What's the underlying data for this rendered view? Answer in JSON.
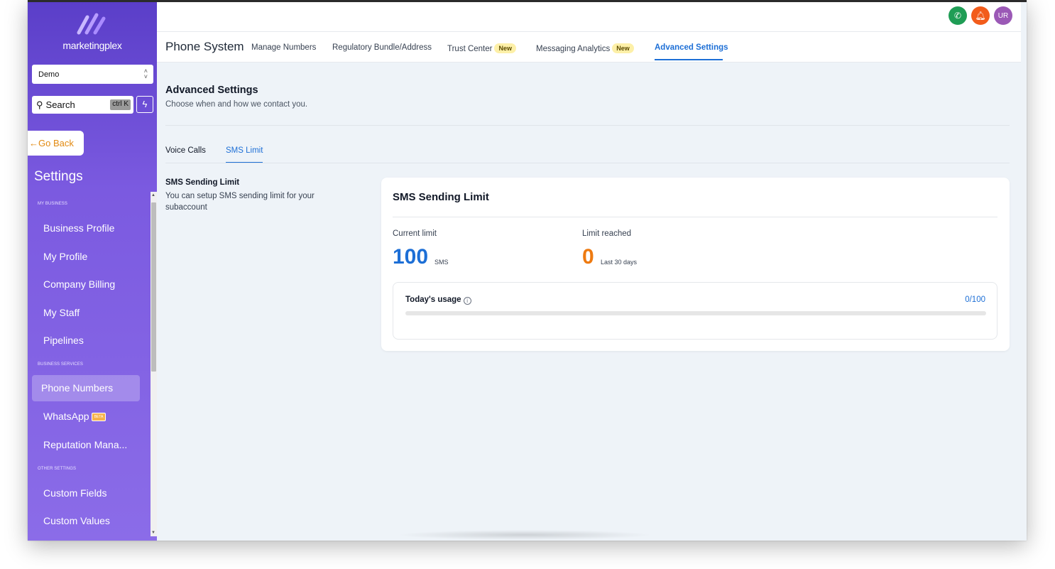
{
  "sidebar": {
    "brand": "marketingplex",
    "account": "Demo",
    "search_placeholder": "Search",
    "search_shortcut": "ctrl K",
    "go_back": "Go Back",
    "settings_title": "Settings",
    "sections": {
      "my_business": "MY BUSINESS",
      "business_services": "BUSINESS SERVICES",
      "other_settings": "OTHER SETTINGS"
    },
    "items": {
      "business_profile": "Business Profile",
      "my_profile": "My Profile",
      "company_billing": "Company Billing",
      "my_staff": "My Staff",
      "pipelines": "Pipelines",
      "phone_numbers": "Phone Numbers",
      "whatsapp": "WhatsApp",
      "whatsapp_badge": "BETA",
      "reputation": "Reputation Mana...",
      "custom_fields": "Custom Fields",
      "custom_values": "Custom Values"
    }
  },
  "header": {
    "avatar_initials": "UR",
    "colors": {
      "phone": "#1f9d55",
      "bell": "#f25c1b",
      "avatar": "#9b59b6"
    }
  },
  "subnav": {
    "title": "Phone System",
    "tabs": {
      "manage_numbers": "Manage Numbers",
      "regulatory": "Regulatory Bundle/Address",
      "trust_center": "Trust Center",
      "messaging_analytics": "Messaging Analytics",
      "advanced_settings": "Advanced Settings",
      "new_badge": "New"
    }
  },
  "page": {
    "title": "Advanced Settings",
    "subtitle": "Choose when and how we contact you.",
    "tabs": {
      "voice_calls": "Voice Calls",
      "sms_limit": "SMS Limit"
    },
    "section_title": "SMS Sending Limit",
    "section_desc": "You can setup SMS sending limit for your subaccount"
  },
  "card": {
    "title": "SMS Sending Limit",
    "current_limit_label": "Current limit",
    "current_limit_value": "100",
    "current_limit_unit": "SMS",
    "limit_reached_label": "Limit reached",
    "limit_reached_value": "0",
    "limit_reached_unit": "Last 30 days",
    "usage_label": "Today's usage",
    "usage_count": "0/100",
    "usage_fraction": 0
  }
}
